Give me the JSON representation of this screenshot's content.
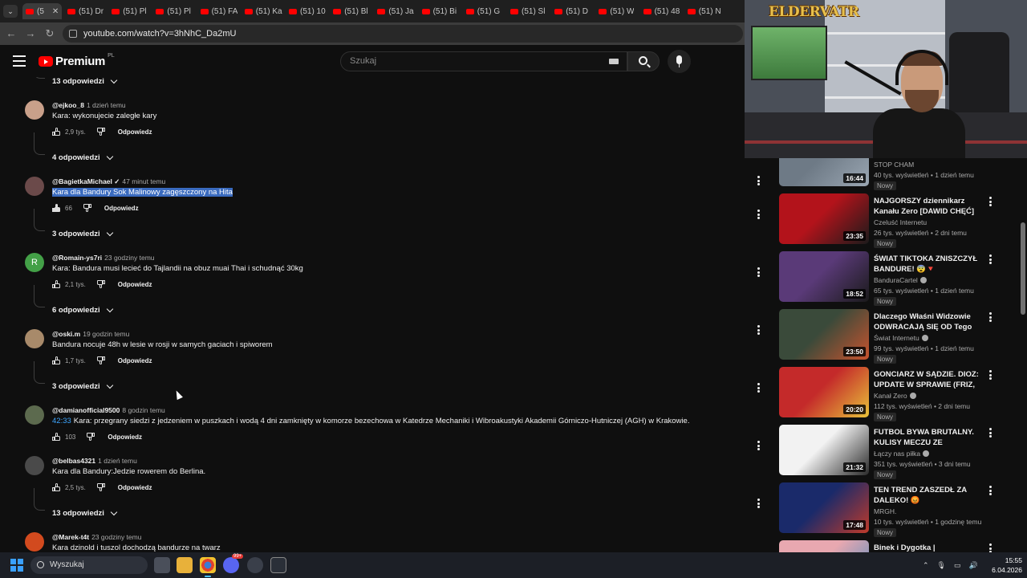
{
  "browser": {
    "tabs": [
      {
        "label": "(5",
        "active": true
      },
      {
        "label": "(51) Dr"
      },
      {
        "label": "(51) Pl"
      },
      {
        "label": "(51) Pl"
      },
      {
        "label": "(51) FA"
      },
      {
        "label": "(51) Ka"
      },
      {
        "label": "(51) 10"
      },
      {
        "label": "(51) Bl"
      },
      {
        "label": "(51) Ja"
      },
      {
        "label": "(51) Bi"
      },
      {
        "label": "(51) G"
      },
      {
        "label": "(51) Sl"
      },
      {
        "label": "(51) D"
      },
      {
        "label": "(51) W"
      },
      {
        "label": "(51) 48"
      },
      {
        "label": "(51) N"
      }
    ],
    "close_tab": "✕",
    "url": "youtube.com/watch?v=3hNhC_Da2mU"
  },
  "header": {
    "brand": "Premium",
    "region": "PL",
    "search_placeholder": "Szukaj"
  },
  "comments": [
    {
      "type": "replies",
      "label": "13 odpowiedzi"
    },
    {
      "type": "comment",
      "author": "@ejkoo_8",
      "time": "1 dzień temu",
      "text": "Kara: wykonujecie zaległe kary",
      "likes": "2,9 tys.",
      "reply": "Odpowiedz",
      "avatar_color": "#c9a08a"
    },
    {
      "type": "replies",
      "label": "4 odpowiedzi"
    },
    {
      "type": "comment",
      "author": "@BagietkaMichael ✓",
      "time": "47 minut temu",
      "text": "Kara dla Bandury Sok Malinowy zagęszczony na Hita",
      "likes": "66",
      "reply": "Odpowiedz",
      "avatar_color": "#6b4a4a",
      "selected": true
    },
    {
      "type": "replies",
      "label": "3 odpowiedzi"
    },
    {
      "type": "comment",
      "author": "@Romain-ys7ri",
      "time": "23 godziny temu",
      "text": "Kara: Bandura musi lecieć do Tajlandii na obuz muai Thai i schudnąć 30kg",
      "likes": "2,1 tys.",
      "reply": "Odpowiedz",
      "avatar_color": "#43a047",
      "avatar_letter": "R"
    },
    {
      "type": "replies",
      "label": "6 odpowiedzi"
    },
    {
      "type": "comment",
      "author": "@oski.m",
      "time": "19 godzin temu",
      "text": "Bandura nocuje 48h w lesie w rosji w samych gaciach i spiworem",
      "likes": "1,7 tys.",
      "reply": "Odpowiedz",
      "avatar_color": "#a88a6a"
    },
    {
      "type": "replies",
      "label": "3 odpowiedzi"
    },
    {
      "type": "comment",
      "author": "@damianofficial9500",
      "time": "8 godzin temu",
      "timestamp_link": "42:33",
      "text": "Kara: przegrany siedzi z jedzeniem w puszkach i wodą 4 dni zamknięty w komorze bezechowa w Katedrze Mechaniki i Wibroakustyki Akademii Górniczo-Hutniczej (AGH) w Krakowie.",
      "likes": "103",
      "reply": "Odpowiedz",
      "avatar_color": "#5c6a4e"
    },
    {
      "type": "comment",
      "author": "@belbas4321",
      "time": "1 dzień temu",
      "text": "Kara dla Bandury:Jedzie rowerem do Berlina.",
      "likes": "2,5 tys.",
      "reply": "Odpowiedz",
      "avatar_color": "#4a4a4a"
    },
    {
      "type": "replies",
      "label": "13 odpowiedzi"
    },
    {
      "type": "comment",
      "author": "@Marek-t4t",
      "time": "23 godziny temu",
      "text": "Kara dzinold i tuszol dochodzą bandurze na twarz",
      "avatar_color": "#d24a1e"
    }
  ],
  "webcam": {
    "logo": "ELDERVATR"
  },
  "sidebar": {
    "videos": [
      {
        "title": "",
        "channel": "STOP CHAM",
        "meta": "40 tys. wyświetleń • 1 dzień temu",
        "badge": "Nowy",
        "duration": "16:44",
        "colors": [
          "#6e7a86",
          "#9aa6b2"
        ],
        "partial": true
      },
      {
        "title": "NAJGORSZY dziennikarz Kanału Zero [DAWID CHĘĆ]",
        "channel": "Czeluść Internetu",
        "meta": "26 tys. wyświetleń • 2 dni temu",
        "badge": "Nowy",
        "duration": "23:35",
        "colors": [
          "#b3131b",
          "#1b1b1b"
        ]
      },
      {
        "title": "ŚWIAT TIKTOKA ZNISZCZYŁ BANDURE! 😨🔻",
        "channel": "BanduraCartel",
        "verified": true,
        "meta": "65 tys. wyświetleń • 1 dzień temu",
        "badge": "Nowy",
        "duration": "18:52",
        "colors": [
          "#5a3a78",
          "#1a1a1a"
        ]
      },
      {
        "title": "Dlaczego Właśni Widzowie ODWRACAJĄ SIĘ OD Tego ...",
        "channel": "Świat Internetu",
        "verified": true,
        "meta": "99 tys. wyświetleń • 1 dzień temu",
        "badge": "Nowy",
        "duration": "23:50",
        "colors": [
          "#3a4a3a",
          "#c8532e"
        ]
      },
      {
        "title": "GONCIARZ W SĄDZIE. DIOZ: UPDATE W SPRAWIE (FRIZ, ...",
        "channel": "Kanał Zero",
        "verified": true,
        "meta": "112 tys. wyświetleń • 2 dni temu",
        "badge": "Nowy",
        "duration": "20:20",
        "colors": [
          "#c42a2a",
          "#e8c23a"
        ]
      },
      {
        "title": "FUTBOL BYWA BRUTALNY. KULISY MECZU ZE SZWECJĄ ...",
        "channel": "Łączy nas piłka",
        "verified": true,
        "meta": "351 tys. wyświetleń • 3 dni temu",
        "badge": "Nowy",
        "duration": "21:32",
        "colors": [
          "#f2f2f2",
          "#2a2a2a"
        ]
      },
      {
        "title": "TEN TREND ZASZEDŁ ZA DALEKO! 😡",
        "channel": "MRGH.",
        "meta": "10 tys. wyświetleń • 1 godzinę temu",
        "badge": "Nowy",
        "duration": "17:48",
        "colors": [
          "#1a2a6a",
          "#c03a2a"
        ]
      },
      {
        "title": "Binek i Dygotka | Wielkanocny",
        "channel": "",
        "meta": "",
        "badge": "",
        "duration": "",
        "colors": [
          "#e8a8b0",
          "#4a8ac0"
        ]
      }
    ]
  },
  "taskbar": {
    "search_label": "Wyszukaj",
    "time": "15:55",
    "date": "6.04.2026",
    "badge_count": "99+"
  }
}
